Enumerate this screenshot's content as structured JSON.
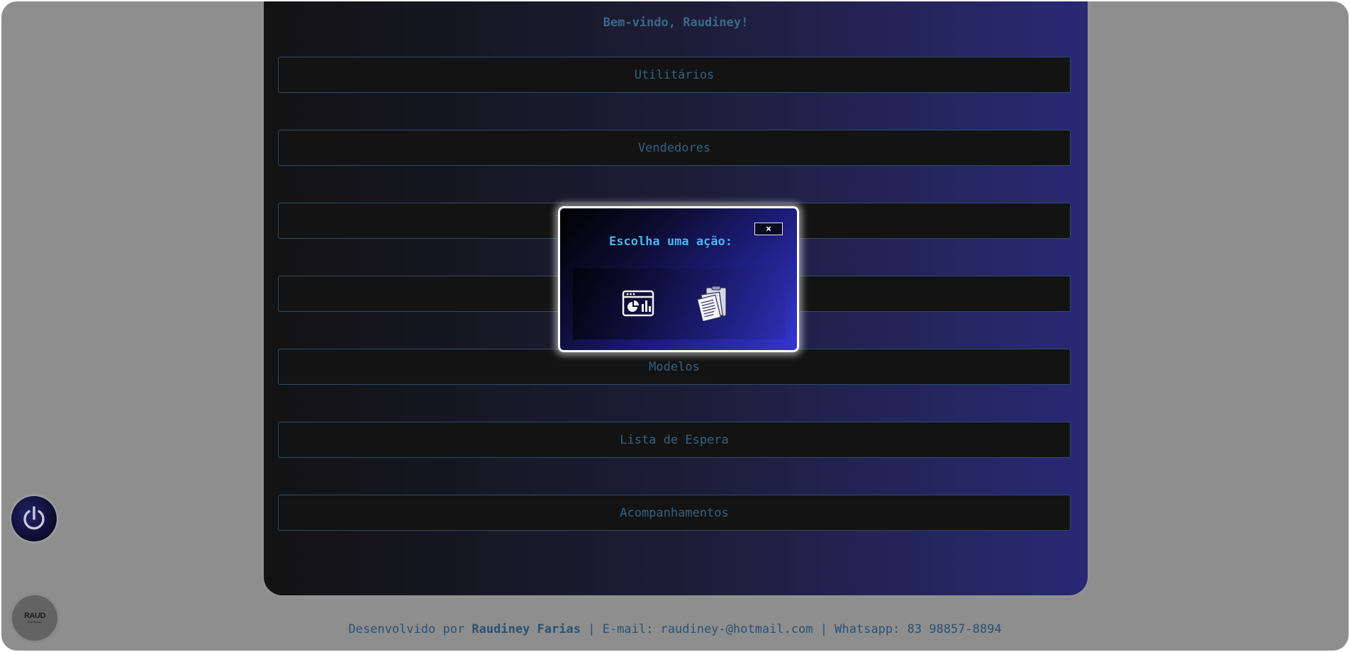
{
  "welcome_text": "Bem-vindo, Raudiney!",
  "menu": {
    "items": [
      {
        "label": "Utilitários"
      },
      {
        "label": "Vendedores"
      },
      {
        "label": ""
      },
      {
        "label": ""
      },
      {
        "label": "Modelos"
      },
      {
        "label": "Lista de Espera"
      },
      {
        "label": "Acompanhamentos"
      }
    ]
  },
  "modal": {
    "title": "Escolha uma ação:",
    "close_label": "×",
    "actions": [
      {
        "icon": "dashboard-chart-icon"
      },
      {
        "icon": "clipboard-documents-icon"
      }
    ]
  },
  "footer": {
    "prefix": "Desenvolvido por ",
    "author": "Raudiney Farias",
    "contact": " | E-mail: raudiney-@hotmail.com | Whatsapp: 83 98857-8894"
  },
  "logo": {
    "main": "RAUD",
    "sub": "SISTEMAS"
  },
  "colors": {
    "accent_text": "#3d95d6",
    "panel_gradient_end": "#2b2bbd",
    "menu_border": "#2f6fa8",
    "modal_title": "#47b4f2"
  },
  "icons": {
    "power": "power-icon"
  }
}
